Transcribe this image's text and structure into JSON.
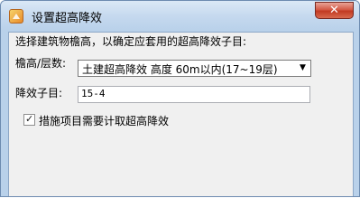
{
  "window": {
    "title": "设置超高降效",
    "close_glyph": "✕"
  },
  "form": {
    "prompt": "选择建筑物檐高，以确定应套用的超高降效子目:",
    "height_label": "檐高/层数:",
    "height_select_value": "土建超高降效 高度 60m以内(17~19层)",
    "subitem_label": "降效子目:",
    "subitem_value": "15-4",
    "checkbox_label": "措施项目需要计取超高降效",
    "checkbox_checked": true
  }
}
